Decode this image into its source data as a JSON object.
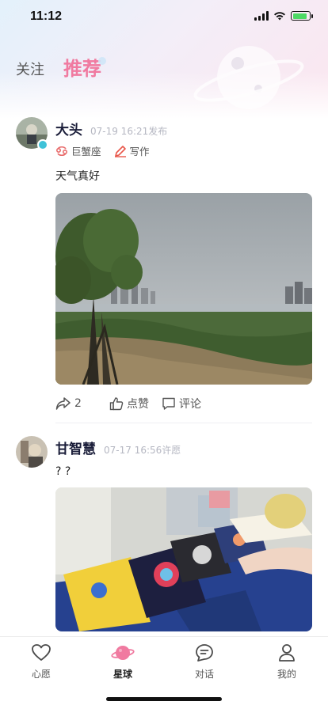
{
  "status_bar": {
    "time": "11:12",
    "battery_level": 0.85,
    "battery_charging": true
  },
  "header": {
    "tabs": [
      {
        "label": "关注",
        "active": false
      },
      {
        "label": "推荐",
        "active": true
      }
    ]
  },
  "posts": [
    {
      "user_name": "大头",
      "time": "07-19 16:21发布",
      "tags": [
        {
          "icon": "zodiac-icon",
          "label": "巨蟹座"
        },
        {
          "icon": "pencil-icon",
          "label": "写作"
        }
      ],
      "text": "天气真好",
      "photo": "lakeside-trees-photo",
      "share_count": "2",
      "like_label": "点赞",
      "comment_label": "评论"
    },
    {
      "user_name": "甘智慧",
      "time": "07-17 16:56许愿",
      "text": "? ?",
      "photo": "books-table-photo"
    }
  ],
  "bottom_nav": [
    {
      "label": "心愿",
      "icon": "heart-icon",
      "active": false
    },
    {
      "label": "星球",
      "icon": "planet-icon",
      "active": true
    },
    {
      "label": "对话",
      "icon": "chat-icon",
      "active": false
    },
    {
      "label": "我的",
      "icon": "person-icon",
      "active": false
    }
  ],
  "colors": {
    "accent": "#f07aa0",
    "name": "#1b1e3a",
    "muted": "#b5b7c2"
  }
}
